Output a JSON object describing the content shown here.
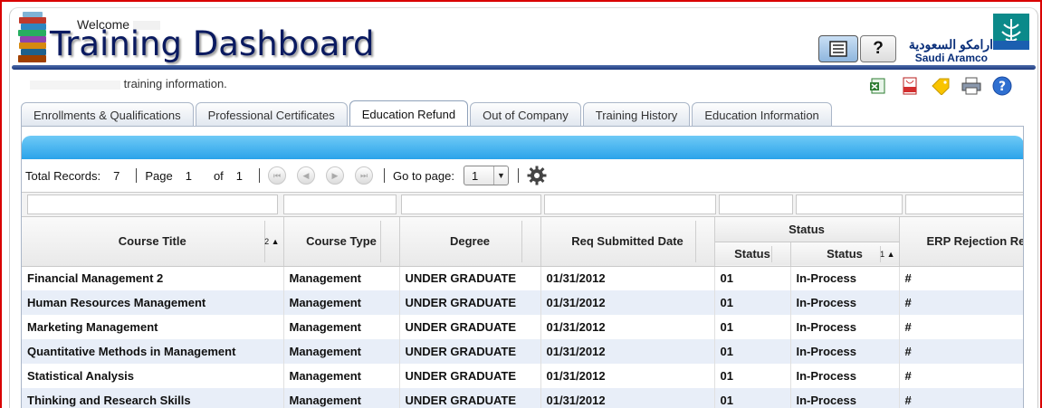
{
  "header": {
    "welcome": "Welcome",
    "title": "Training Dashboard",
    "grid_button_icon": "grid-view-icon",
    "help_button_label": "?",
    "brand_arabic": "ارامكو السعودية",
    "brand_english": "Saudi Aramco"
  },
  "info_text": "training information.",
  "toolbar_icons": [
    "excel-export-icon",
    "pdf-export-icon",
    "tag-icon",
    "print-icon",
    "help-icon"
  ],
  "tabs": [
    {
      "label": "Enrollments & Qualifications",
      "active": false
    },
    {
      "label": "Professional Certificates",
      "active": false
    },
    {
      "label": "Education Refund",
      "active": true
    },
    {
      "label": "Out of Company",
      "active": false
    },
    {
      "label": "Training History",
      "active": false
    },
    {
      "label": "Education Information",
      "active": false
    }
  ],
  "pager": {
    "total_label": "Total Records:",
    "total_value": "7",
    "page_label": "Page",
    "page_value": "1",
    "of_label": "of",
    "of_value": "1",
    "goto_label": "Go to page:",
    "goto_value": "1"
  },
  "table": {
    "status_group_header": "Status",
    "columns": [
      {
        "label": "Course Title",
        "sort": "2 ▲"
      },
      {
        "label": "Course Type",
        "sort": ""
      },
      {
        "label": "Degree",
        "sort": ""
      },
      {
        "label": "Req Submitted Date",
        "sort": ""
      },
      {
        "label": "Status",
        "sort": ""
      },
      {
        "label": "Status",
        "sort": "1 ▲"
      },
      {
        "label": "ERP Rejection Rea",
        "sort": ""
      }
    ],
    "rows": [
      [
        "Financial Management 2",
        "Management",
        "UNDER GRADUATE",
        "01/31/2012",
        "01",
        "In-Process",
        "#"
      ],
      [
        "Human Resources Management",
        "Management",
        "UNDER GRADUATE",
        "01/31/2012",
        "01",
        "In-Process",
        "#"
      ],
      [
        "Marketing Management",
        "Management",
        "UNDER GRADUATE",
        "01/31/2012",
        "01",
        "In-Process",
        "#"
      ],
      [
        "Quantitative Methods in Management",
        "Management",
        "UNDER GRADUATE",
        "01/31/2012",
        "01",
        "In-Process",
        "#"
      ],
      [
        "Statistical Analysis",
        "Management",
        "UNDER GRADUATE",
        "01/31/2012",
        "01",
        "In-Process",
        "#"
      ],
      [
        "Thinking and Research Skills",
        "Management",
        "UNDER GRADUATE",
        "01/31/2012",
        "01",
        "In-Process",
        "#"
      ]
    ]
  },
  "colors": {
    "accent_blue": "#2aa3ea",
    "title_navy": "#0a1a60",
    "frame_red": "#d90000",
    "row_alt": "#e8eef8"
  }
}
